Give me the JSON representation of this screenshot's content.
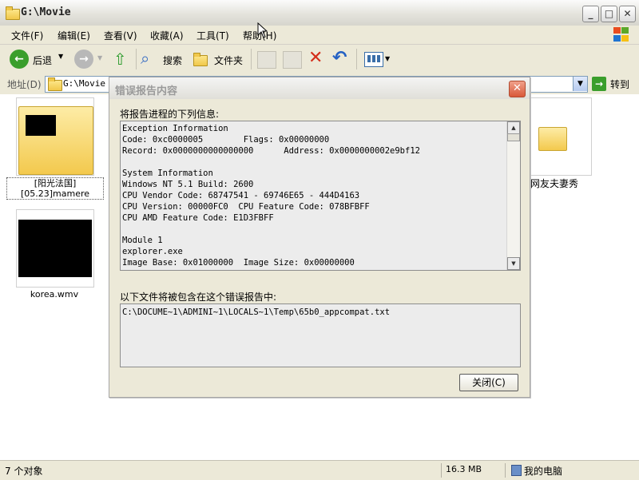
{
  "window": {
    "title": "G:\\Movie"
  },
  "menu": [
    "文件(F)",
    "编辑(E)",
    "查看(V)",
    "收藏(A)",
    "工具(T)",
    "帮助(H)"
  ],
  "toolbar": {
    "back": "后退",
    "search": "搜索",
    "folders": "文件夹"
  },
  "address": {
    "label": "地址(D)",
    "value": "G:\\Movie",
    "go": "转到"
  },
  "files": [
    {
      "name": "[阳光法国][05.23]mamere"
    },
    {
      "name": "korea.wmv"
    },
    {
      "name": "网友夫妻秀"
    }
  ],
  "status": {
    "count": "7 个对象",
    "size": "16.3 MB",
    "location": "我的电脑"
  },
  "dialog": {
    "title": "错误报告内容",
    "info_label": "将报告进程的下列信息:",
    "info_text": "Exception Information\nCode: 0xc0000005        Flags: 0x00000000\nRecord: 0x0000000000000000      Address: 0x0000000002e9bf12\n\nSystem Information\nWindows NT 5.1 Build: 2600\nCPU Vendor Code: 68747541 - 69746E65 - 444D4163\nCPU Version: 00000FC0  CPU Feature Code: 078BFBFF\nCPU AMD Feature Code: E1D3FBFF\n\nModule 1\nexplorer.exe\nImage Base: 0x01000000  Image Size: 0x00000000",
    "files_label": "以下文件将被包含在这个错误报告中:",
    "files_text": "C:\\DOCUME~1\\ADMINI~1\\LOCALS~1\\Temp\\65b0_appcompat.txt",
    "close_label": "关闭(C)"
  }
}
